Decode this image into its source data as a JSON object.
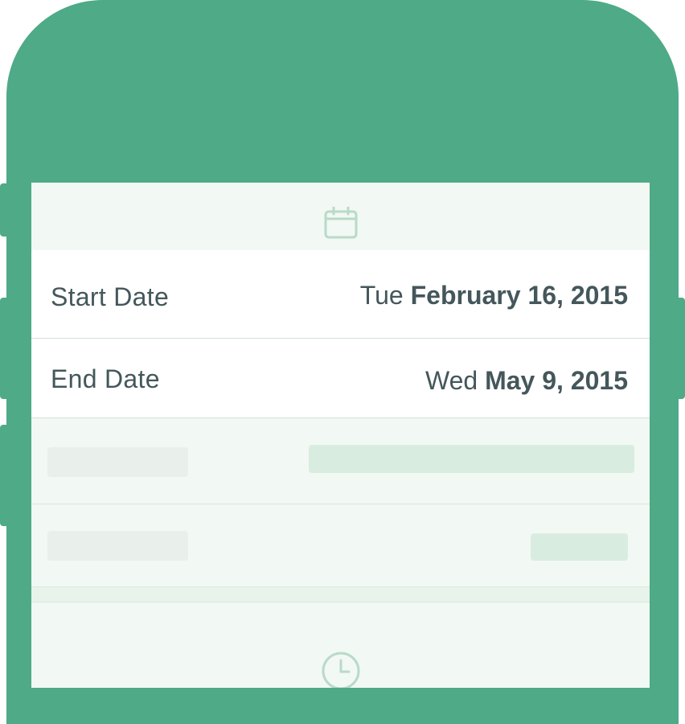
{
  "header": {
    "icon": "calendar-icon"
  },
  "start_date": {
    "label": "Start Date",
    "day": "Tue",
    "date": "February 16, 2015"
  },
  "end_date": {
    "label": "End Date",
    "day": "Wed",
    "date": "May 9, 2015"
  },
  "footer": {
    "icon": "clock-icon"
  },
  "colors": {
    "phone_body": "#4eaa87",
    "screen_bg": "#f2f8f3",
    "text": "#44575b",
    "icon": "#b9dac9"
  }
}
